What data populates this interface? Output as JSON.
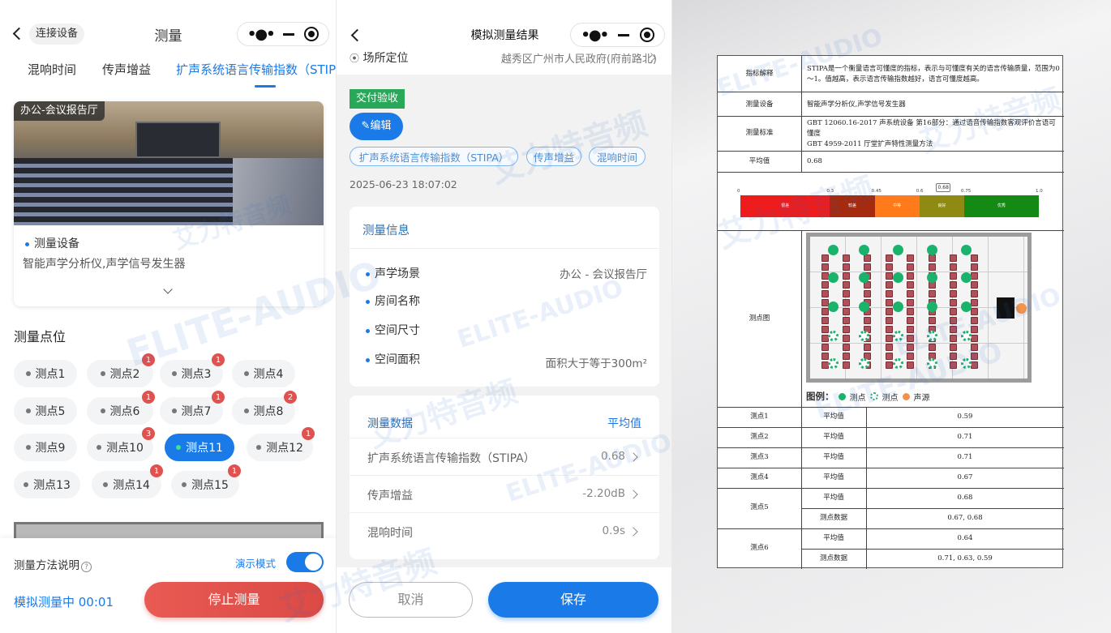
{
  "panel1": {
    "back_label": "连接设备",
    "title": "测量",
    "tabs": [
      "混响时间",
      "传声增益",
      "扩声系统语言传输指数（STIP"
    ],
    "room_tag": "办公-会议报告厅",
    "device_heading": "测量设备",
    "device_value": "智能声学分析仪,声学信号发生器",
    "points_heading": "测量点位",
    "points": [
      {
        "label": "测点1",
        "badge": ""
      },
      {
        "label": "测点2",
        "badge": "1"
      },
      {
        "label": "测点3",
        "badge": "1"
      },
      {
        "label": "测点4",
        "badge": ""
      },
      {
        "label": "测点5",
        "badge": ""
      },
      {
        "label": "测点6",
        "badge": "1"
      },
      {
        "label": "测点7",
        "badge": "1"
      },
      {
        "label": "测点8",
        "badge": "2"
      },
      {
        "label": "测点9",
        "badge": ""
      },
      {
        "label": "测点10",
        "badge": "3"
      },
      {
        "label": "测点11",
        "badge": ""
      },
      {
        "label": "测点12",
        "badge": "1"
      },
      {
        "label": "测点13",
        "badge": ""
      },
      {
        "label": "测点14",
        "badge": "1"
      },
      {
        "label": "测点15",
        "badge": "1"
      }
    ],
    "active_point": "测点11",
    "method_label": "测量方法说明",
    "demo_label": "演示模式",
    "demo_on": true,
    "status_text": "模拟测量中 00:01",
    "stop_button": "停止测量"
  },
  "panel2": {
    "title": "模拟测量结果",
    "location_label": "场所定位",
    "location_value": "越秀区广州市人民政府(府前路北)",
    "status_tag": "交付验收",
    "edit_button": "编辑",
    "tags": [
      "扩声系统语言传输指数（STIPA）",
      "传声增益",
      "混响时间"
    ],
    "datetime": "2025-06-23 18:07:02",
    "info_title": "测量信息",
    "info_rows": [
      {
        "label": "声学场景",
        "value": "办公 - 会议报告厅"
      },
      {
        "label": "房间名称",
        "value": ""
      },
      {
        "label": "空间尺寸",
        "value": ""
      },
      {
        "label": "空间面积",
        "value": "面积大于等于300m²"
      }
    ],
    "data_title": "测量数据",
    "data_avg_header": "平均值",
    "data_rows": [
      {
        "label": "扩声系统语言传输指数（STIPA）",
        "value": "0.68"
      },
      {
        "label": "传声增益",
        "value": "-2.20dB"
      },
      {
        "label": "混响时间",
        "value": "0.9s"
      }
    ],
    "cancel_button": "取消",
    "save_button": "保存"
  },
  "document": {
    "row_labels": [
      "指标解释",
      "测量设备",
      "测量标准",
      "平均值",
      "测点图"
    ],
    "explain": "STIPA是一个衡量语言可懂度的指标，表示与可懂度有关的语言传输质量，范围为0～1。值越高，表示语言传输指数越好，语言可懂度越高。",
    "device": "智能声学分析仪,声学信号发生器",
    "standard_1": "GBT 12060.16-2017 声系统设备 第16部分：通过语音传输指数客观评价言语可懂度",
    "standard_2": "GBT 4959-2011 厅堂扩声特性测量方法",
    "average": "0.68",
    "scale_ticks": [
      "0",
      "0.3",
      "0.45",
      "0.6",
      "0.75",
      "1.0"
    ],
    "scale_marker": "0.68",
    "scale_bands": [
      {
        "label": "很差",
        "color": "#ee1c1c"
      },
      {
        "label": "较差",
        "color": "#a52a0e"
      },
      {
        "label": "中等",
        "color": "#ff7a1a"
      },
      {
        "label": "良好",
        "color": "#8e8a12"
      },
      {
        "label": "优秀",
        "color": "#148a14"
      }
    ],
    "legend_title": "图例：",
    "legend_items": [
      "测点",
      "测点",
      "声源"
    ],
    "points_table": [
      {
        "name": "测点1",
        "rows": [
          {
            "k": "平均值",
            "v": "0.59"
          }
        ]
      },
      {
        "name": "测点2",
        "rows": [
          {
            "k": "平均值",
            "v": "0.71"
          }
        ]
      },
      {
        "name": "测点3",
        "rows": [
          {
            "k": "平均值",
            "v": "0.71"
          }
        ]
      },
      {
        "name": "测点4",
        "rows": [
          {
            "k": "平均值",
            "v": "0.67"
          }
        ]
      },
      {
        "name": "测点5",
        "rows": [
          {
            "k": "平均值",
            "v": "0.68"
          },
          {
            "k": "测点数据",
            "v": "0.67, 0.68"
          }
        ]
      },
      {
        "name": "测点6",
        "rows": [
          {
            "k": "平均值",
            "v": "0.64"
          },
          {
            "k": "测点数据",
            "v": "0.71, 0.63, 0.59"
          }
        ]
      }
    ]
  },
  "watermark": {
    "cn": "艾力特音频",
    "en": "ELITE-AUDIO"
  },
  "colors": {
    "accent": "#1a7ae8",
    "danger": "#e0524f",
    "tag_green": "#29a85a"
  }
}
